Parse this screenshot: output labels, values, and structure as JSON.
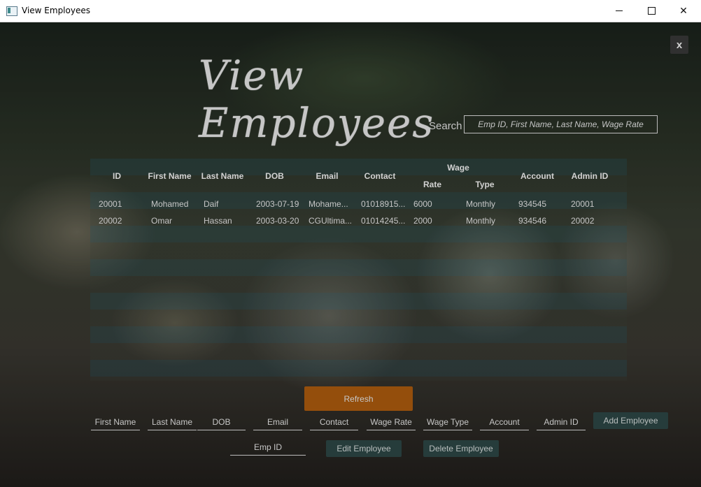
{
  "window": {
    "title": "View Employees",
    "minimize": "—",
    "maximize": "☐",
    "close": "✕"
  },
  "header": {
    "title": "View Employees",
    "close_label": "x"
  },
  "search": {
    "label": "Search",
    "placeholder": "Emp ID, First Name, Last Name, Wage Rate"
  },
  "table": {
    "headers": {
      "id": "ID",
      "first_name": "First Name",
      "last_name": "Last Name",
      "dob": "DOB",
      "email": "Email",
      "contact": "Contact",
      "wage": "Wage",
      "rate": "Rate",
      "type": "Type",
      "account": "Account",
      "admin_id": "Admin ID"
    },
    "rows": [
      [
        "20001",
        "Mohamed",
        "Daif",
        "2003-07-19",
        "Mohame...",
        "01018915...",
        "6000",
        "Monthly",
        "934545",
        "20001"
      ],
      [
        "20002",
        "Omar",
        "Hassan",
        "2003-03-20",
        "CGUltima...",
        "01014245...",
        "2000",
        "Monthly",
        "934546",
        "20002"
      ]
    ]
  },
  "actions": {
    "refresh": "Refresh",
    "add": "Add Employee",
    "edit": "Edit Employee",
    "delete": "Delete Employee"
  },
  "form": {
    "first_name": "First Name",
    "last_name": "Last Name",
    "dob": "DOB",
    "email": "Email",
    "contact": "Contact",
    "wage_rate": "Wage Rate",
    "wage_type": "Wage Type",
    "account": "Account",
    "admin_id": "Admin ID",
    "emp_id": "Emp ID"
  },
  "colors": {
    "accent": "#b5600f",
    "button": "#2f4a49"
  }
}
